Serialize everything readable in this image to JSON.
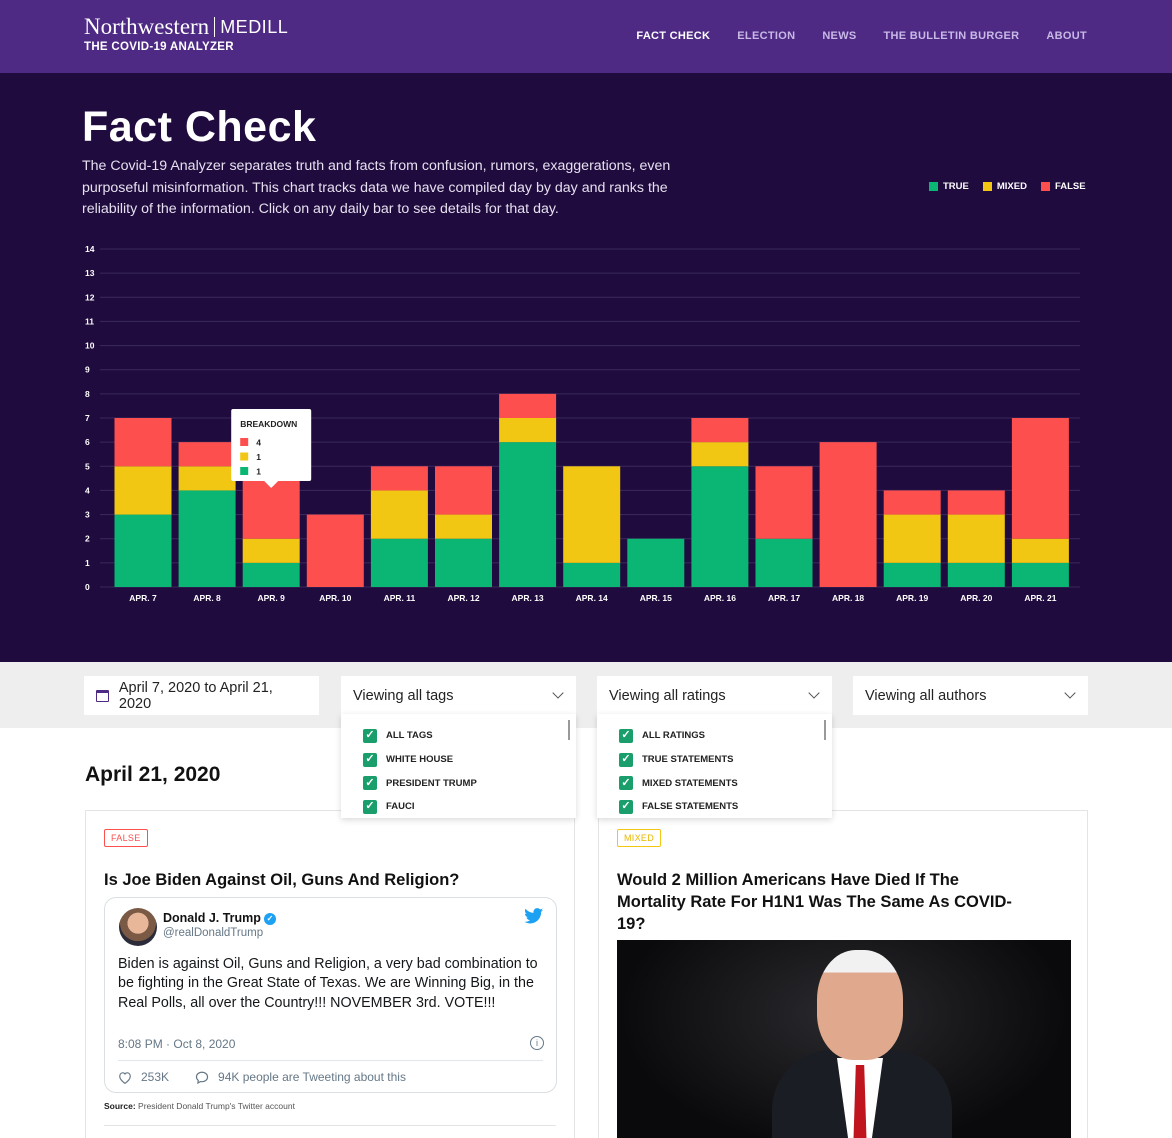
{
  "header": {
    "brand_name": "Northwestern",
    "brand_school": "MEDILL",
    "brand_sub": "THE COVID-19 ANALYZER",
    "nav": [
      "FACT CHECK",
      "ELECTION",
      "NEWS",
      "THE BULLETIN BURGER",
      "ABOUT"
    ],
    "active_nav": "FACT CHECK",
    "bg_color": "#4e2a84"
  },
  "hero": {
    "title": "Fact Check",
    "description": "The Covid-19 Analyzer separates truth and facts from confusion, rumors, exaggerations, even purposeful misinformation. This chart tracks data we have compiled day by day and ranks the reliability of the information. Click on any daily bar to see details for that day.",
    "bg_color": "#1f0b3d",
    "legend": [
      {
        "label": "TRUE",
        "color": "#0bb573"
      },
      {
        "label": "MIXED",
        "color": "#f2c714"
      },
      {
        "label": "FALSE",
        "color": "#fe4f4f"
      }
    ]
  },
  "chart_data": {
    "type": "bar",
    "stacked": true,
    "categories": [
      "APR. 7",
      "APR. 8",
      "APR. 9",
      "APR. 10",
      "APR. 11",
      "APR. 12",
      "APR. 13",
      "APR. 14",
      "APR. 15",
      "APR. 16",
      "APR. 17",
      "APR. 18",
      "APR. 19",
      "APR. 20",
      "APR. 21"
    ],
    "series": [
      {
        "name": "TRUE",
        "color": "#0bb573",
        "values": [
          3,
          4,
          1,
          0,
          2,
          2,
          6,
          1,
          2,
          5,
          2,
          0,
          1,
          1,
          1
        ]
      },
      {
        "name": "MIXED",
        "color": "#f2c714",
        "values": [
          2,
          1,
          1,
          0,
          2,
          1,
          1,
          4,
          0,
          1,
          0,
          0,
          2,
          2,
          1
        ]
      },
      {
        "name": "FALSE",
        "color": "#fe4f4f",
        "values": [
          2,
          1,
          4,
          3,
          1,
          2,
          1,
          0,
          0,
          1,
          3,
          6,
          1,
          1,
          5
        ]
      }
    ],
    "ylim": [
      0,
      14
    ],
    "yticks": [
      0,
      1,
      2,
      3,
      4,
      5,
      6,
      7,
      8,
      9,
      10,
      11,
      12,
      13,
      14
    ],
    "grid": true,
    "tooltip": {
      "title": "BREAKDOWN",
      "category": "APR. 9",
      "rows": [
        {
          "value": "4",
          "color": "#fe4f4f"
        },
        {
          "value": "1",
          "color": "#f2c714"
        },
        {
          "value": "1",
          "color": "#0bb573"
        }
      ]
    }
  },
  "filters": {
    "date_range": "April 7, 2020 to April 21, 2020",
    "tags": "Viewing all tags",
    "ratings": "Viewing all ratings",
    "authors": "Viewing all authors",
    "tag_options": [
      "ALL TAGS",
      "WHITE HOUSE",
      "PRESIDENT TRUMP",
      "FAUCI"
    ],
    "rating_options": [
      "ALL RATINGS",
      "TRUE STATEMENTS",
      "MIXED STATEMENTS",
      "FALSE STATEMENTS"
    ]
  },
  "content": {
    "date_heading": "April 21, 2020",
    "cards": [
      {
        "badge": "FALSE",
        "badge_color": "#fe4f4f",
        "title": "Is Joe Biden Against Oil, Guns And Religion?",
        "tweet": {
          "name": "Donald J. Trump",
          "handle": "@realDonaldTrump",
          "body": "Biden is against Oil, Guns and Religion, a very bad combination to be fighting in the Great State of Texas. We are Winning Big, in the Real Polls, all over the Country!!! NOVEMBER 3rd. VOTE!!!",
          "time": "8:08 PM · Oct 8, 2020",
          "likes": "253K",
          "tweeting": "94K people are Tweeting about this"
        },
        "source_label": "Source:",
        "source_text": "President Donald Trump's Twitter account"
      },
      {
        "badge": "MIXED",
        "badge_color": "#e8b800",
        "title": "Would 2 Million Americans Have Died If The Mortality Rate For H1N1 Was The Same As COVID-19?"
      }
    ]
  }
}
